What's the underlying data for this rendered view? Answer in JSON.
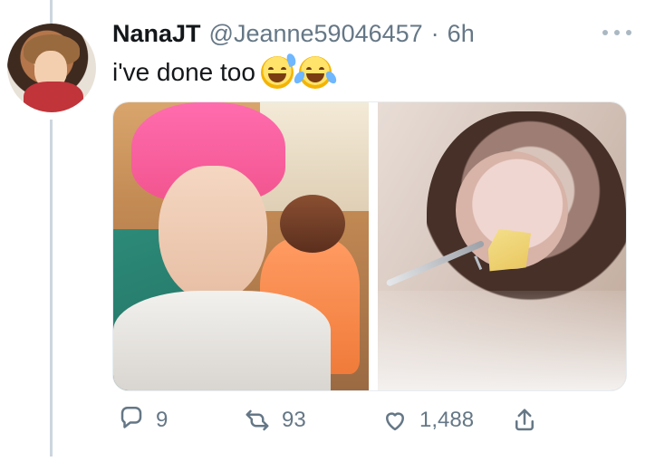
{
  "tweet": {
    "author_name": "NanaJT",
    "handle": "@Jeanne59046457",
    "separator": "·",
    "time": "6h",
    "text": "i've done too",
    "emojis": [
      "sweat-smile-icon",
      "joy-icon"
    ]
  },
  "actions": {
    "reply_count": "9",
    "retweet_count": "93",
    "like_count": "1,488"
  },
  "icons": {
    "reply": "reply-icon",
    "retweet": "retweet-icon",
    "like": "heart-icon",
    "share": "share-icon",
    "more": "more-icon"
  },
  "colors": {
    "text": "#14171a",
    "secondary": "#657786",
    "thread": "#ccd6dd"
  }
}
